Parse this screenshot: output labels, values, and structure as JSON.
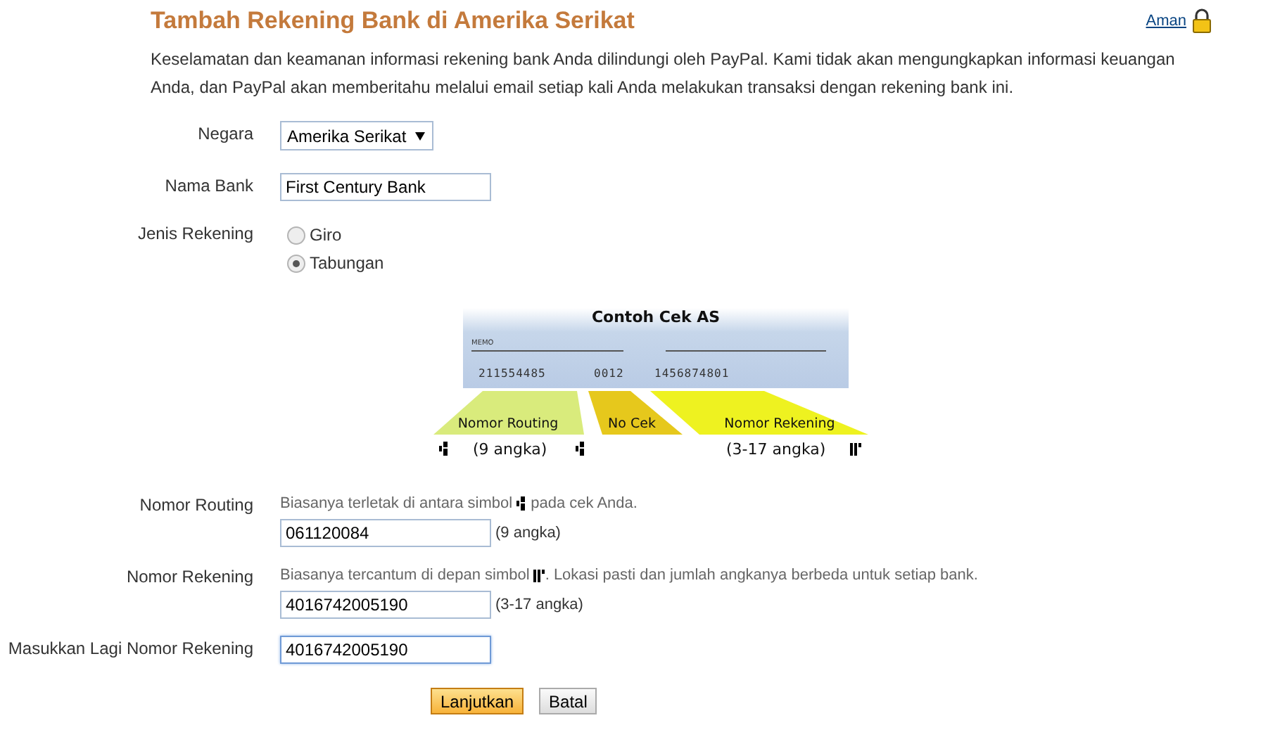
{
  "header": {
    "title": "Tambah Rekening Bank di Amerika Serikat",
    "secure_link": "Aman"
  },
  "intro": "Keselamatan dan keamanan informasi rekening bank Anda dilindungi oleh PayPal. Kami tidak akan mengungkapkan informasi keuangan Anda, dan PayPal akan memberitahu melalui email setiap kali Anda melakukan transaksi dengan rekening bank ini.",
  "form": {
    "country": {
      "label": "Negara",
      "value": "Amerika Serikat"
    },
    "bank_name": {
      "label": "Nama Bank",
      "value": "First Century Bank"
    },
    "account_type": {
      "label": "Jenis Rekening",
      "options": [
        {
          "label": "Giro",
          "selected": false
        },
        {
          "label": "Tabungan",
          "selected": true
        }
      ]
    }
  },
  "check_example": {
    "title": "Contoh Cek AS",
    "memo": "MEMO",
    "routing_digits": "211554485",
    "check_digits": "0012",
    "account_digits": "1456874801",
    "segments": [
      {
        "label": "Nomor Routing",
        "color": "#d9eb7c"
      },
      {
        "label": "No Cek",
        "color": "#e6c81c"
      },
      {
        "label": "Nomor Rekening",
        "color": "#eef220"
      }
    ],
    "routing_count": "(9 angka)",
    "account_count": "(3-17 angka)"
  },
  "routing": {
    "label": "Nomor Routing",
    "hint_before": "Biasanya terletak di antara simbol",
    "hint_after": "pada cek Anda.",
    "value": "061120084",
    "count": "(9 angka)"
  },
  "account": {
    "label": "Nomor Rekening",
    "hint_before": "Biasanya tercantum di depan simbol",
    "hint_after": ". Lokasi pasti dan jumlah angkanya berbeda untuk setiap bank.",
    "value": "4016742005190",
    "count": "(3-17 angka)"
  },
  "account_confirm": {
    "label": "Masukkan Lagi Nomor Rekening",
    "value": "4016742005190",
    "focused": true
  },
  "buttons": [
    {
      "label": "Lanjutkan",
      "kind": "primary"
    },
    {
      "label": "Batal",
      "kind": "secondary"
    }
  ]
}
